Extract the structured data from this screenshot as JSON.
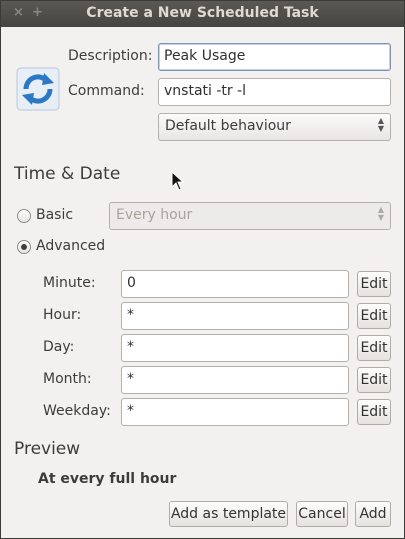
{
  "window": {
    "title": "Create a New Scheduled Task",
    "close_glyph": "×",
    "plus_glyph": "+"
  },
  "task": {
    "description_label": "Description:",
    "description_value": "Peak Usage",
    "command_label": "Command:",
    "command_value": "vnstati -tr -l",
    "behaviour_selected": "Default behaviour",
    "icon": "refresh-icon"
  },
  "time_date": {
    "heading": "Time & Date",
    "basic_label": "Basic",
    "basic_selected": false,
    "basic_combo_value": "Every hour",
    "advanced_label": "Advanced",
    "advanced_selected": true,
    "fields": [
      {
        "label": "Minute:",
        "value": "0",
        "edit": "Edit"
      },
      {
        "label": "Hour:",
        "value": "*",
        "edit": "Edit"
      },
      {
        "label": "Day:",
        "value": "*",
        "edit": "Edit"
      },
      {
        "label": "Month:",
        "value": "*",
        "edit": "Edit"
      },
      {
        "label": "Weekday:",
        "value": "*",
        "edit": "Edit"
      }
    ]
  },
  "preview": {
    "heading": "Preview",
    "text": "At every full hour"
  },
  "buttons": {
    "add_template": "Add as template",
    "cancel": "Cancel",
    "add": "Add"
  },
  "colors": {
    "titlebar": "#4e4d49",
    "window_bg": "#f2f1f0",
    "icon_blue": "#3b82c8"
  }
}
